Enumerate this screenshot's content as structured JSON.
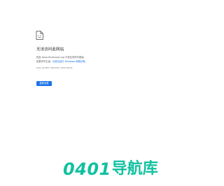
{
  "error_page": {
    "icon": "document-error-icon",
    "title": "无法访问此网站",
    "description": {
      "prefix": "检查 ",
      "host": "www.faceboook.org",
      "middle": " 中是否有拼写错误。",
      "line2_prefix": "如果拼写无误，",
      "link": "请尝试运行 Windows 网络诊断",
      "line2_suffix": "。"
    },
    "error_code": "DNS_PROBE_FINISHED_NXDOMAIN",
    "reload_label": "重新加载",
    "accent_color": "#1a73e8"
  },
  "watermark": {
    "digits": "0401",
    "text": "导航库",
    "color": "#12c1a1"
  }
}
